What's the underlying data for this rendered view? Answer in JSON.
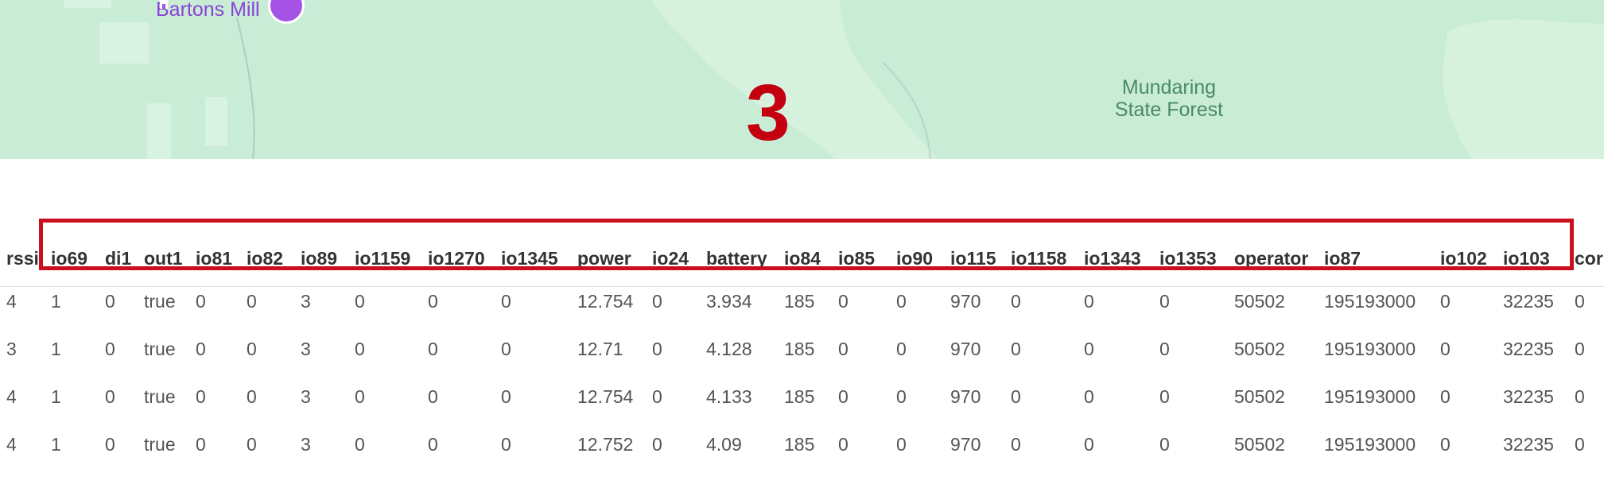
{
  "map": {
    "poi_label": "Bartons Mill",
    "forest_label_line1": "Mundaring",
    "forest_label_line2": "State Forest",
    "step_marker": "3",
    "colors": {
      "land": "#c8ecd5",
      "poi": "#a552e6",
      "marker": "#c40010"
    }
  },
  "table": {
    "columns": [
      "rssi",
      "io69",
      "di1",
      "out1",
      "io81",
      "io82",
      "io89",
      "io1159",
      "io1270",
      "io1345",
      "power",
      "io24",
      "battery",
      "io84",
      "io85",
      "io90",
      "io115",
      "io1158",
      "io1343",
      "io1353",
      "operator",
      "io87",
      "io102",
      "io103",
      "cor"
    ],
    "rows": [
      [
        "4",
        "1",
        "0",
        "true",
        "0",
        "0",
        "3",
        "0",
        "0",
        "0",
        "12.754",
        "0",
        "3.934",
        "185",
        "0",
        "0",
        "970",
        "0",
        "0",
        "0",
        "50502",
        "195193000",
        "0",
        "32235",
        "0"
      ],
      [
        "3",
        "1",
        "0",
        "true",
        "0",
        "0",
        "3",
        "0",
        "0",
        "0",
        "12.71",
        "0",
        "4.128",
        "185",
        "0",
        "0",
        "970",
        "0",
        "0",
        "0",
        "50502",
        "195193000",
        "0",
        "32235",
        "0"
      ],
      [
        "4",
        "1",
        "0",
        "true",
        "0",
        "0",
        "3",
        "0",
        "0",
        "0",
        "12.754",
        "0",
        "4.133",
        "185",
        "0",
        "0",
        "970",
        "0",
        "0",
        "0",
        "50502",
        "195193000",
        "0",
        "32235",
        "0"
      ],
      [
        "4",
        "1",
        "0",
        "true",
        "0",
        "0",
        "3",
        "0",
        "0",
        "0",
        "12.752",
        "0",
        "4.09",
        "185",
        "0",
        "0",
        "970",
        "0",
        "0",
        "0",
        "50502",
        "195193000",
        "0",
        "32235",
        "0"
      ]
    ]
  }
}
